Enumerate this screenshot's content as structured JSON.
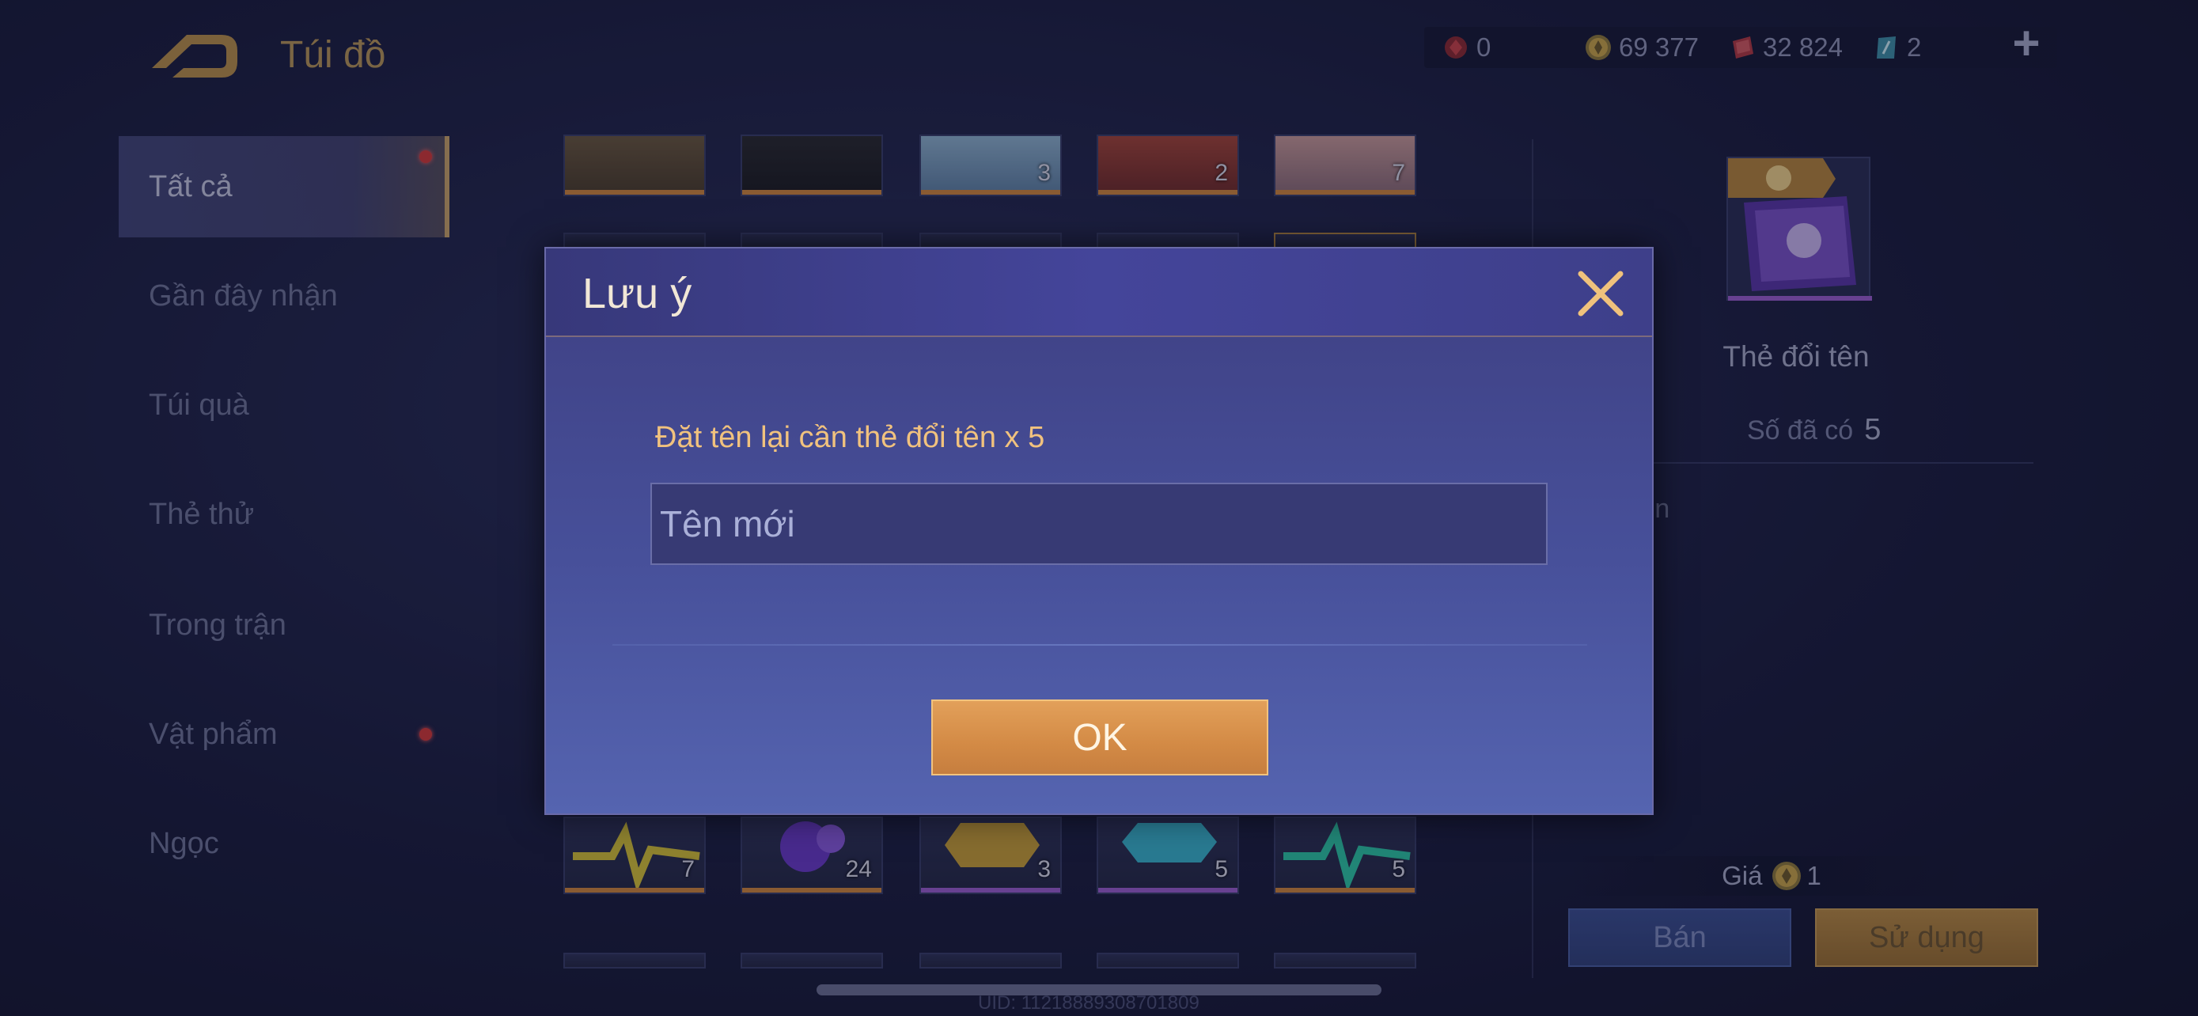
{
  "header": {
    "title": "Túi đồ",
    "back_icon": "back-arrow-icon",
    "currencies": [
      {
        "icon": "red-gem-icon",
        "value": "0",
        "color": "#b5363e"
      },
      {
        "icon": "gold-coin-icon",
        "value": "69 377",
        "color": "#c9a54b"
      },
      {
        "icon": "voucher-icon",
        "value": "32 824",
        "color": "#c0474f"
      },
      {
        "icon": "card-icon",
        "value": "2",
        "color": "#3f8fa8"
      }
    ],
    "plus_label": "+"
  },
  "sidebar": {
    "items": [
      {
        "label": "Tất cả",
        "active": true,
        "dot": true
      },
      {
        "label": "Gần đây nhận",
        "active": false,
        "dot": false
      },
      {
        "label": "Túi quà",
        "active": false,
        "dot": false
      },
      {
        "label": "Thẻ thử",
        "active": false,
        "dot": false
      },
      {
        "label": "Trong trận",
        "active": false,
        "dot": false
      },
      {
        "label": "Vật phẩm",
        "active": false,
        "dot": true
      },
      {
        "label": "Ngọc",
        "active": false,
        "dot": false
      }
    ]
  },
  "grid": {
    "top_row_counts": [
      "",
      "",
      "3",
      "2",
      "7"
    ],
    "bottom_row_counts": [
      "7",
      "24",
      "3",
      "5",
      "5"
    ]
  },
  "detail": {
    "item_name": "Thẻ đổi tên",
    "owned_label": "Số đã có",
    "owned_value": "5",
    "description": "i tên",
    "price_label": "Giá",
    "price_value": "1",
    "sell_label": "Bán",
    "use_label": "Sử dụng"
  },
  "footer": {
    "uid": "UID: 11218889308701809"
  },
  "modal": {
    "title": "Lưu ý",
    "message": "Đặt tên lại cần thẻ đổi tên x 5",
    "input_placeholder": "Tên mới",
    "input_value": "",
    "ok_label": "OK"
  },
  "colors": {
    "accent_gold": "#c9a46a",
    "modal_bg": "#47509a",
    "ok_button": "#d38a45",
    "message_text": "#f1c27e"
  }
}
